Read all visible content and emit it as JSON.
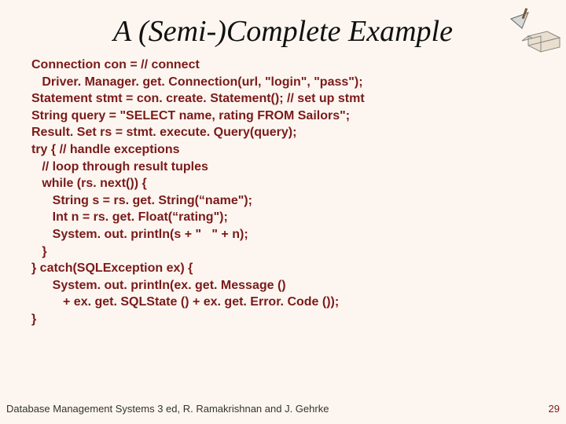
{
  "title": "A (Semi-)Complete Example",
  "code_lines": [
    "Connection con = // connect",
    "   Driver. Manager. get. Connection(url, \"login\", \"pass\");",
    "Statement stmt = con. create. Statement(); // set up stmt",
    "String query = \"SELECT name, rating FROM Sailors\";",
    "Result. Set rs = stmt. execute. Query(query);",
    "try { // handle exceptions",
    "   // loop through result tuples",
    "   while (rs. next()) {",
    "      String s = rs. get. String(“name\");",
    "      Int n = rs. get. Float(“rating\");",
    "      System. out. println(s + \"   \" + n);",
    "   }",
    "} catch(SQLException ex) {",
    "      System. out. println(ex. get. Message ()",
    "         + ex. get. SQLState () + ex. get. Error. Code ());",
    "}"
  ],
  "footer_left": "Database Management Systems 3 ed,  R. Ramakrishnan and J. Gehrke",
  "footer_right": "29"
}
